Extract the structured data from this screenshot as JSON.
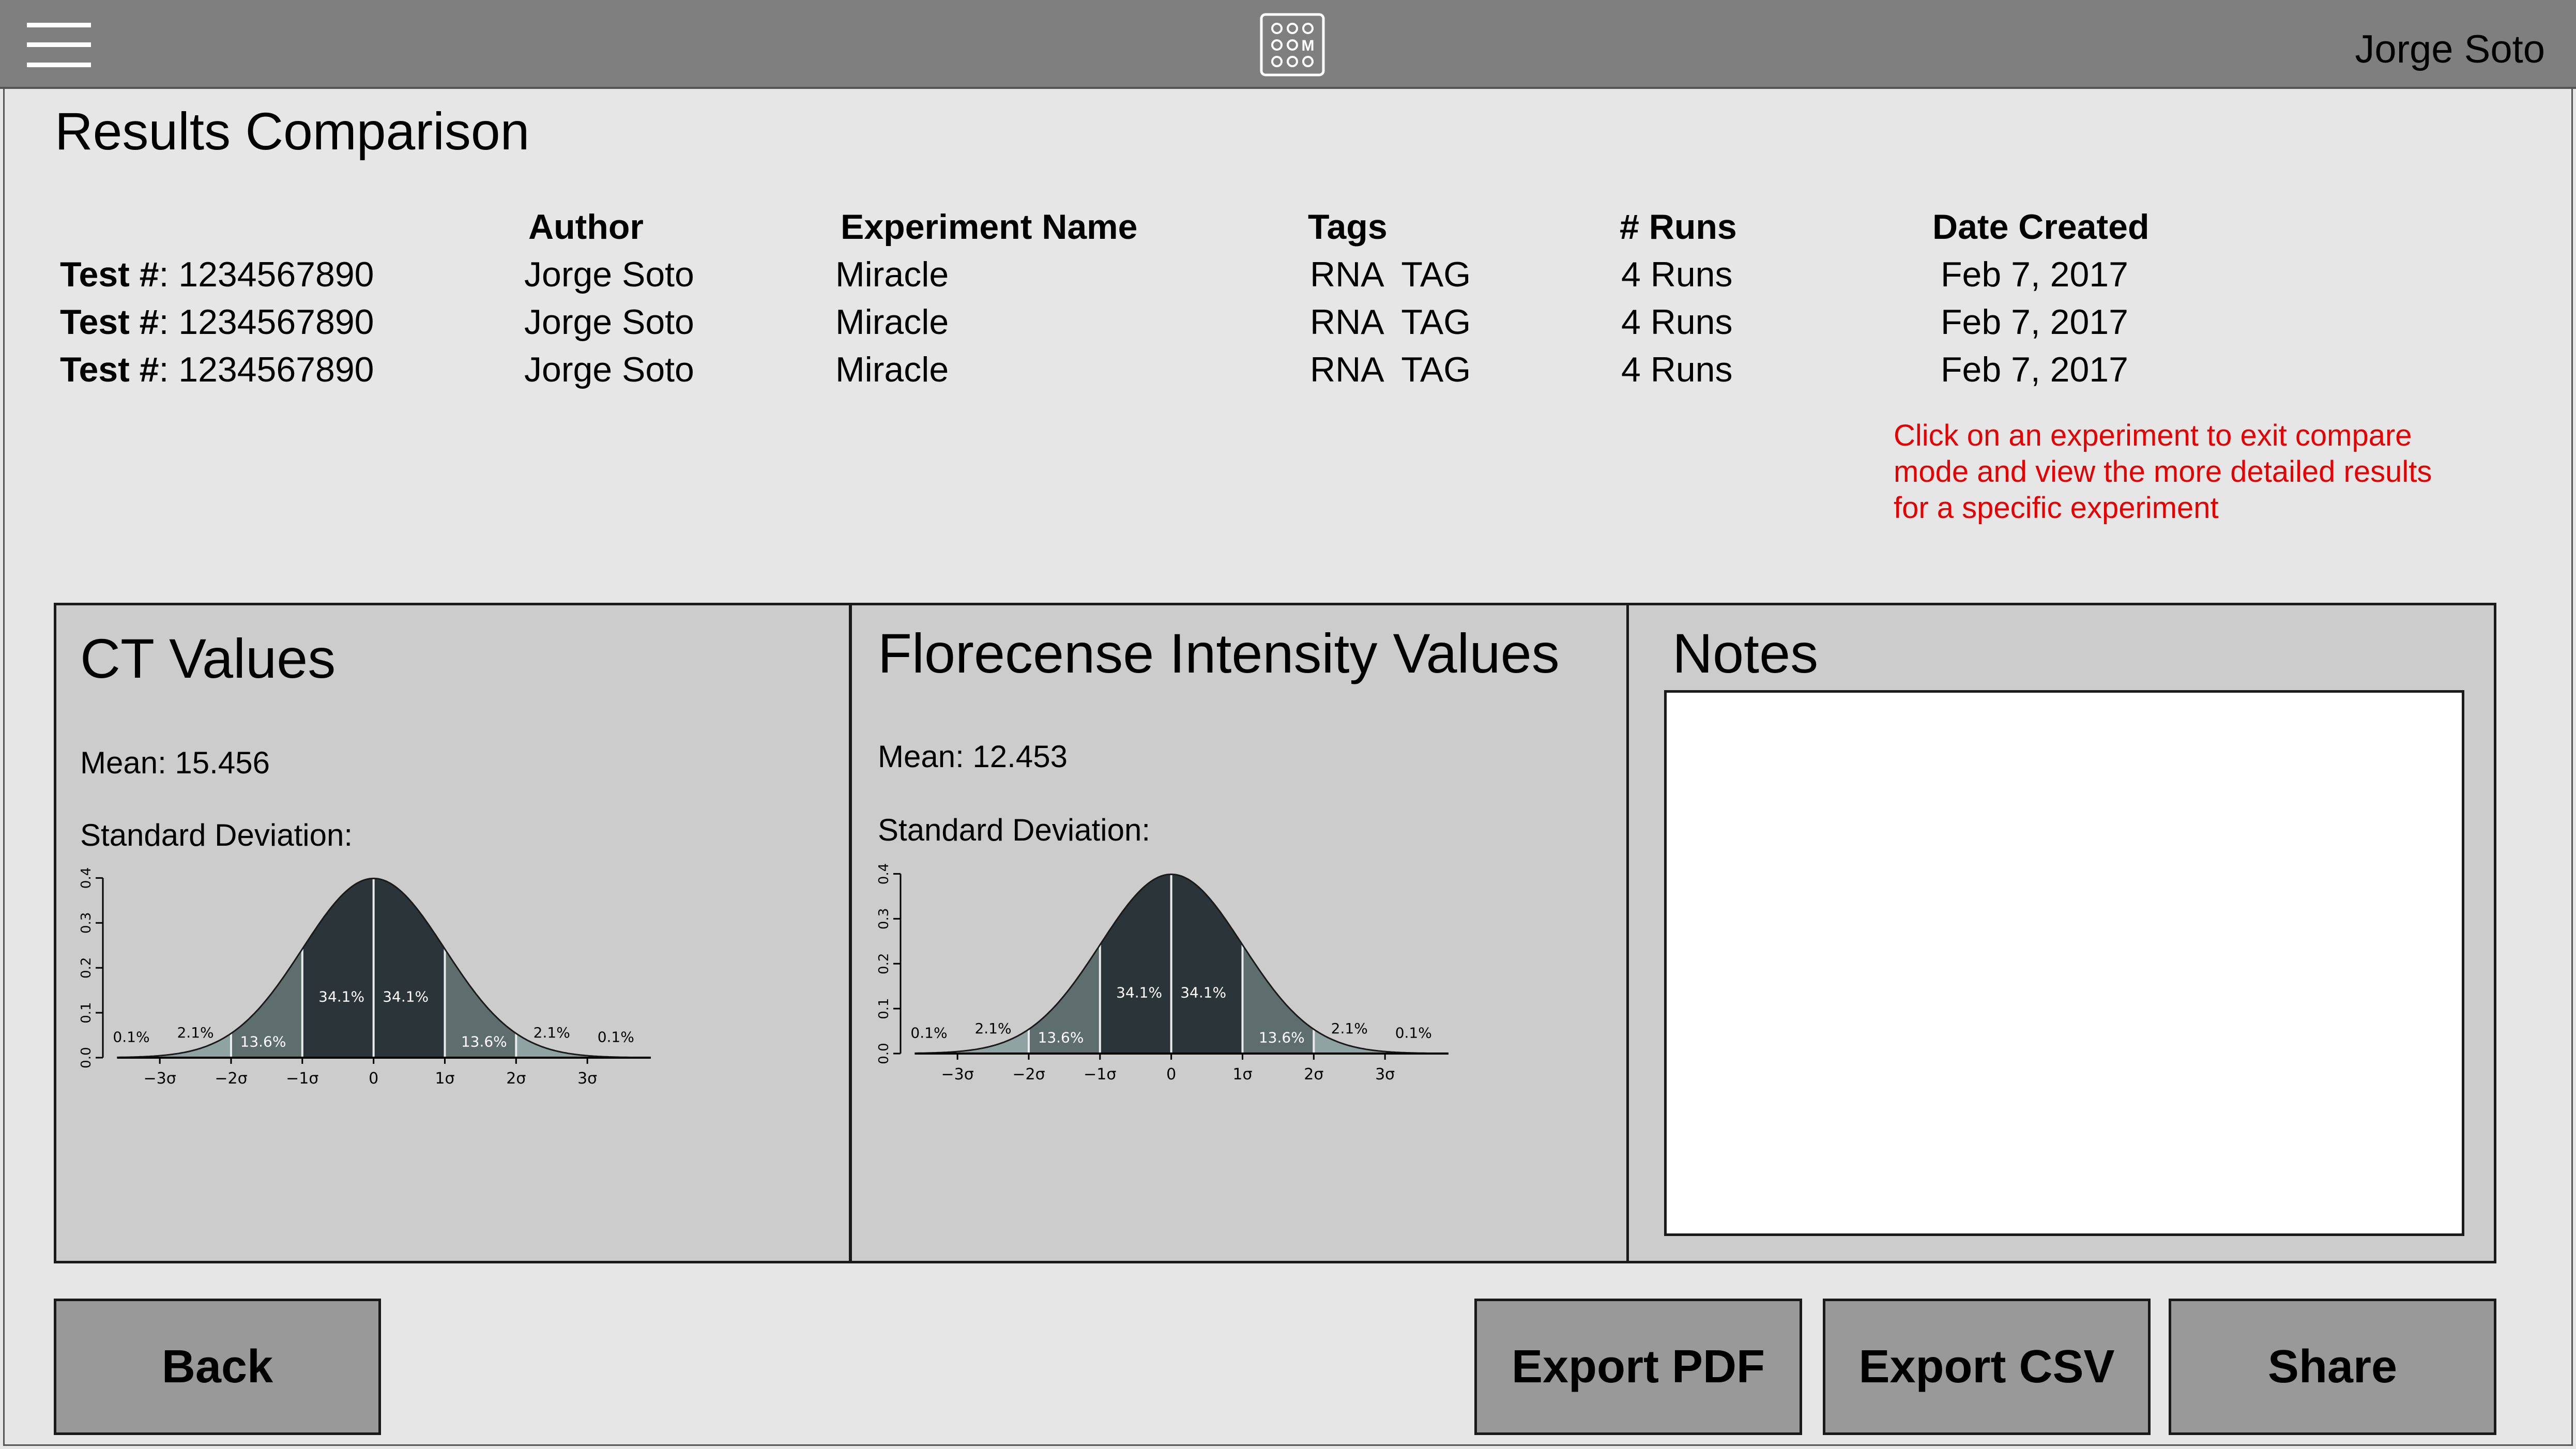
{
  "header": {
    "user_name": "Jorge Soto"
  },
  "page": {
    "title": "Results Comparison"
  },
  "table": {
    "columns": [
      "Author",
      "Experiment Name",
      "Tags",
      "# Runs",
      "Date Created"
    ],
    "rows": [
      {
        "test_label": "Test #",
        "test_number": ": 1234567890",
        "author": "Jorge Soto",
        "experiment": "Miracle",
        "tags": "RNA  TAG",
        "runs": "4 Runs",
        "date": "Feb 7, 2017"
      },
      {
        "test_label": "Test #",
        "test_number": ": 1234567890",
        "author": "Jorge Soto",
        "experiment": "Miracle",
        "tags": "RNA  TAG",
        "runs": "4 Runs",
        "date": "Feb 7, 2017"
      },
      {
        "test_label": "Test #",
        "test_number": ": 1234567890",
        "author": "Jorge Soto",
        "experiment": "Miracle",
        "tags": "RNA  TAG",
        "runs": "4 Runs",
        "date": "Feb 7, 2017"
      }
    ]
  },
  "hint": {
    "line1": "Click on an experiment to exit compare",
    "line2": "mode and view the more detailed results",
    "line3": "for a specific experiment"
  },
  "ct_panel": {
    "title": "CT Values",
    "mean": "Mean: 15.456",
    "std_label": "Standard Deviation:"
  },
  "fi_panel": {
    "title": "Florecense Intensity Values",
    "mean": "Mean: 12.453",
    "std_label": "Standard Deviation:"
  },
  "notes_panel": {
    "title": "Notes",
    "value": ""
  },
  "buttons": {
    "back": "Back",
    "export_pdf": "Export PDF",
    "export_csv": "Export CSV",
    "share": "Share"
  },
  "chart_data": [
    {
      "type": "area",
      "title": "",
      "x_ticks": [
        "−3σ",
        "−2σ",
        "−1σ",
        "0",
        "1σ",
        "2σ",
        "3σ"
      ],
      "y_ticks": [
        "0.0",
        "0.1",
        "0.2",
        "0.3",
        "0.4"
      ],
      "xlim": [
        -3.4,
        4
      ],
      "ylim": [
        0,
        0.42
      ],
      "curve": "standard normal density",
      "band_labels": [
        "0.1%",
        "2.1%",
        "13.6%",
        "34.1%",
        "34.1%",
        "13.6%",
        "2.1%",
        "0.1%"
      ],
      "colors": {
        "inner": "#2b3438",
        "middle": "#5d6e6d",
        "outer": "#8fa3a3",
        "tail": "#b6c4c4"
      }
    },
    {
      "type": "area",
      "title": "",
      "x_ticks": [
        "−3σ",
        "−2σ",
        "−1σ",
        "0",
        "1σ",
        "2σ",
        "3σ"
      ],
      "y_ticks": [
        "0.0",
        "0.1",
        "0.2",
        "0.3",
        "0.4"
      ],
      "xlim": [
        -3.4,
        4
      ],
      "ylim": [
        0,
        0.42
      ],
      "curve": "standard normal density",
      "band_labels": [
        "0.1%",
        "2.1%",
        "13.6%",
        "34.1%",
        "34.1%",
        "13.6%",
        "2.1%",
        "0.1%"
      ],
      "colors": {
        "inner": "#2b3438",
        "middle": "#5d6e6d",
        "outer": "#8fa3a3",
        "tail": "#b6c4c4"
      }
    }
  ]
}
